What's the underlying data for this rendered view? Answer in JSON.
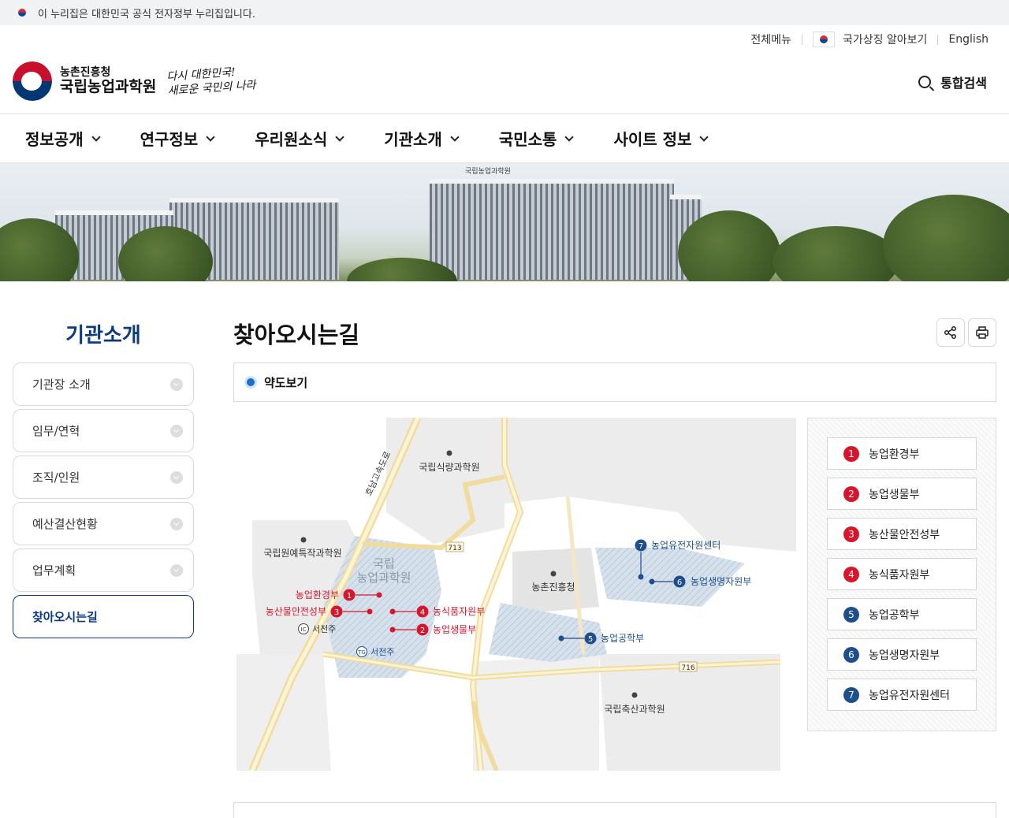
{
  "gov_banner": {
    "text": "이 누리집은 대한민국 공식 전자정부 누리집입니다."
  },
  "header": {
    "util_links": {
      "all_menu": "전체메뉴",
      "national_symbol": "국가상징 알아보기",
      "english": "English"
    },
    "logo": {
      "org_small": "농촌진흥청",
      "org_big": "국립농업과학원",
      "slogan_line1": "다시 대한민국!",
      "slogan_line2": "새로운 국민의 나라"
    },
    "search_label": "통합검색"
  },
  "gnb": {
    "items": [
      {
        "label": "정보공개"
      },
      {
        "label": "연구정보"
      },
      {
        "label": "우리원소식"
      },
      {
        "label": "기관소개"
      },
      {
        "label": "국민소통"
      },
      {
        "label": "사이트 정보"
      }
    ]
  },
  "hero": {
    "sign_text": "국립농업과학원"
  },
  "lnb": {
    "title": "기관소개",
    "items": [
      {
        "label": "기관장 소개"
      },
      {
        "label": "임무/연혁"
      },
      {
        "label": "조직/인원"
      },
      {
        "label": "예산결산현황"
      },
      {
        "label": "업무계획"
      },
      {
        "label": "찾아오시는길"
      }
    ]
  },
  "content": {
    "title": "찾아오시는길",
    "tab": "약도보기",
    "icons": {
      "share": "share-icon",
      "print": "print-icon"
    }
  },
  "map": {
    "places": {
      "food_science": "국립식량과학원",
      "horticulture": "국립원예특작과학원",
      "rda": "농촌진흥청",
      "animal_science": "국립축산과학원",
      "campus_line1": "국립",
      "campus_line2": "농업과학원"
    },
    "road_labels": {
      "expressway": "호남고속도로",
      "r713": "713",
      "r716": "716",
      "ic": "서전주",
      "tg": "서전주",
      "ic_mark": "IC",
      "tg_mark": "TG"
    },
    "markers": [
      {
        "num": "1",
        "label": "농업환경부"
      },
      {
        "num": "2",
        "label": "농업생물부"
      },
      {
        "num": "3",
        "label": "농산물안전성부"
      },
      {
        "num": "4",
        "label": "농식품자원부"
      },
      {
        "num": "5",
        "label": "농업공학부"
      },
      {
        "num": "6",
        "label": "농업생명자원부"
      },
      {
        "num": "7",
        "label": "농업유전자원센터"
      }
    ]
  },
  "legend": {
    "items": [
      {
        "num": "1",
        "label": "농업환경부",
        "color": "#d7162d"
      },
      {
        "num": "2",
        "label": "농업생물부",
        "color": "#d7162d"
      },
      {
        "num": "3",
        "label": "농산물안전성부",
        "color": "#d7162d"
      },
      {
        "num": "4",
        "label": "농식품자원부",
        "color": "#d7162d"
      },
      {
        "num": "5",
        "label": "농업공학부",
        "color": "#1f4e8c"
      },
      {
        "num": "6",
        "label": "농업생명자원부",
        "color": "#1f4e8c"
      },
      {
        "num": "7",
        "label": "농업유전자원센터",
        "color": "#1f4e8c"
      }
    ]
  },
  "colors": {
    "brand_navy": "#0b3a7e",
    "marker_red": "#d7162d",
    "marker_blue": "#1f4e8c"
  }
}
